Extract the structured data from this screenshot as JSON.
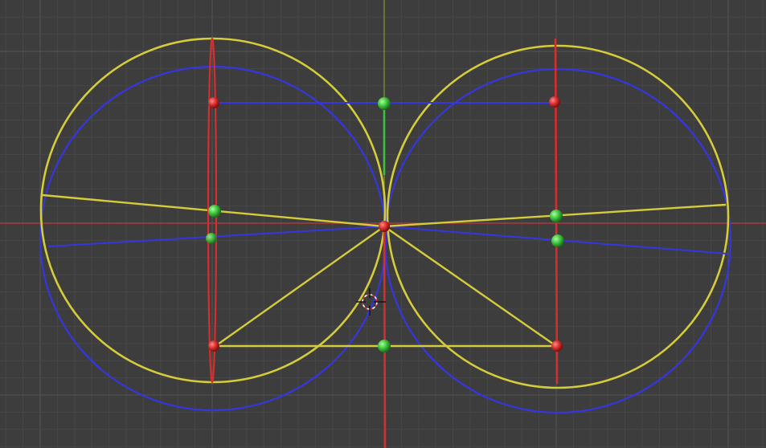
{
  "viewport": {
    "name": "3D Viewport",
    "background_color": "#3d3d3d",
    "grid_minor_color": "#474747",
    "grid_major_color": "#555555",
    "x_axis_color": "#c0393f",
    "y_axis_color": "#7f9a2a"
  },
  "colors": {
    "yellow_curve": "#d4cc3a",
    "blue_curve": "#3636e0",
    "red_element": "#d62d2d",
    "green_element": "#3cc23c"
  },
  "objects": {
    "left_yellow_circle": "yellow-circle-left",
    "right_yellow_circle": "yellow-circle-right",
    "left_blue_circle": "blue-circle-left",
    "right_blue_circle": "blue-circle-right",
    "cursor": "3d-cursor-icon"
  }
}
